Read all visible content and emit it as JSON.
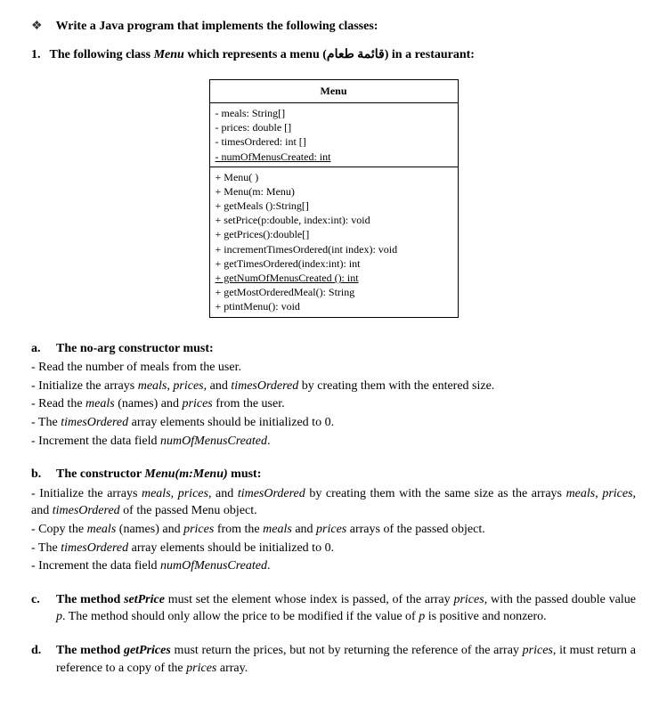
{
  "header": {
    "prompt": "Write a Java program that implements the following classes:"
  },
  "item1": {
    "num": "1.",
    "pre": "The following class ",
    "cls": "Menu",
    "mid": " which represents a menu ",
    "arabic": "(قائمة طعام)",
    "post": " in a restaurant:"
  },
  "uml": {
    "title": "Menu",
    "attrs": [
      "- meals: String[]",
      "- prices: double []",
      "- timesOrdered: int []"
    ],
    "attr_static": "- numOfMenusCreated: int",
    "ops1": [
      "+ Menu( )",
      "+ Menu(m: Menu)",
      "+ getMeals ():String[]",
      "+ setPrice(p:double, index:int): void",
      "+ getPrices():double[]",
      "+ incrementTimesOrdered(int index): void",
      "+ getTimesOrdered(index:int): int"
    ],
    "op_static": "+ getNumOfMenusCreated (): int",
    "ops2": [
      "+ getMostOrderedMeal(): String",
      "+ ptintMenu(): void"
    ]
  },
  "a": {
    "label": "a.",
    "head": "The no-arg constructor must:",
    "b1": "- Read the number of meals from the user.",
    "b2_pre": "- Initialize the arrays ",
    "b2_m": "meals",
    "b2_c1": ", ",
    "b2_p": "prices",
    "b2_c2": ", and ",
    "b2_t": "timesOrdered",
    "b2_post": " by creating them with the entered size.",
    "b3_pre": "- Read the ",
    "b3_m": "meals",
    "b3_mid": " (names) and ",
    "b3_p": "prices",
    "b3_post": " from the user.",
    "b4_pre": "- The ",
    "b4_t": "timesOrdered",
    "b4_post": " array elements should be initialized to 0.",
    "b5_pre": "- Increment the data field ",
    "b5_n": "numOfMenusCreated",
    "b5_post": "."
  },
  "b": {
    "label": "b.",
    "head_pre": "The constructor ",
    "head_sig": "Menu(m:Menu)",
    "head_post": " must:",
    "b1_pre": "- Initialize the arrays ",
    "b1_m": "meals",
    "b1_c1": ", ",
    "b1_p": "prices",
    "b1_c2": ", and ",
    "b1_t": "timesOrdered",
    "b1_mid": " by creating them with the same size as the arrays ",
    "b1_m2": "meals",
    "b1_c3": ", ",
    "b1_p2": "prices",
    "b1_c4": ", and ",
    "b1_t2": "timesOrdered",
    "b1_post": " of the passed Menu object.",
    "b2_pre": "- Copy the ",
    "b2_m": "meals",
    "b2_mid1": " (names) and ",
    "b2_p": "prices",
    "b2_mid2": " from the ",
    "b2_m2": "meals",
    "b2_mid3": " and ",
    "b2_p2": "prices",
    "b2_post": " arrays of the passed object.",
    "b3_pre": "- The ",
    "b3_t": "timesOrdered",
    "b3_post": " array elements should be initialized to 0.",
    "b4_pre": "- Increment the data field ",
    "b4_n": "numOfMenusCreated",
    "b4_post": "."
  },
  "c": {
    "label": "c.",
    "pre": "The method ",
    "meth": "setPrice",
    "mid1": " must set the element whose index is passed, of the array ",
    "arr": "prices",
    "mid2": ", with the passed double value ",
    "p1": "p",
    "mid3": ". The method should only allow the price to be modified if the value of ",
    "p2": "p",
    "post": " is positive and nonzero."
  },
  "d": {
    "label": "d.",
    "pre": "The method ",
    "meth": "getPrices",
    "mid1": " must return the prices, but not by returning the reference of the array ",
    "arr": "prices",
    "mid2": ", it must return a reference to a copy of the ",
    "arr2": "prices",
    "post": " array."
  }
}
